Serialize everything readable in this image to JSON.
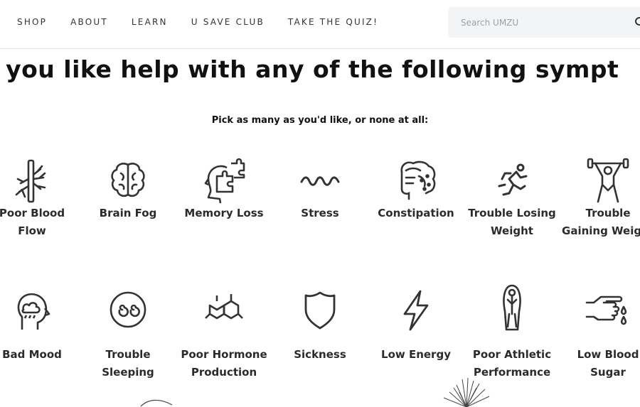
{
  "nav": {
    "items": [
      "SHOP",
      "ABOUT",
      "LEARN",
      "U SAVE CLUB",
      "TAKE THE QUIZ!"
    ]
  },
  "search": {
    "placeholder": "Search UMZU"
  },
  "headline": "d you like help with any of the following sympt",
  "subhead": "Pick as many as you'd like, or none at all:",
  "symptoms": [
    {
      "label": "Poor Blood Flow",
      "icon": "blood-vessel-icon"
    },
    {
      "label": "Brain Fog",
      "icon": "brain-icon"
    },
    {
      "label": "Memory Loss",
      "icon": "head-puzzle-icon"
    },
    {
      "label": "Stress",
      "icon": "squiggle-wave-icon"
    },
    {
      "label": "Constipation",
      "icon": "intestines-icon"
    },
    {
      "label": "Trouble Losing Weight",
      "icon": "runner-icon"
    },
    {
      "label": "Trouble Gaining Weight",
      "icon": "weightlifter-icon"
    },
    {
      "label": "Bad Mood",
      "icon": "head-cloud-icon"
    },
    {
      "label": "Trouble Sleeping",
      "icon": "dizzy-face-icon"
    },
    {
      "label": "Poor Hormone Production",
      "icon": "molecule-icon"
    },
    {
      "label": "Sickness",
      "icon": "shield-icon"
    },
    {
      "label": "Low Energy",
      "icon": "lightning-bolt-icon"
    },
    {
      "label": "Poor Athletic Performance",
      "icon": "jump-rope-icon"
    },
    {
      "label": "Low Blood Sugar",
      "icon": "finger-drop-icon"
    }
  ]
}
